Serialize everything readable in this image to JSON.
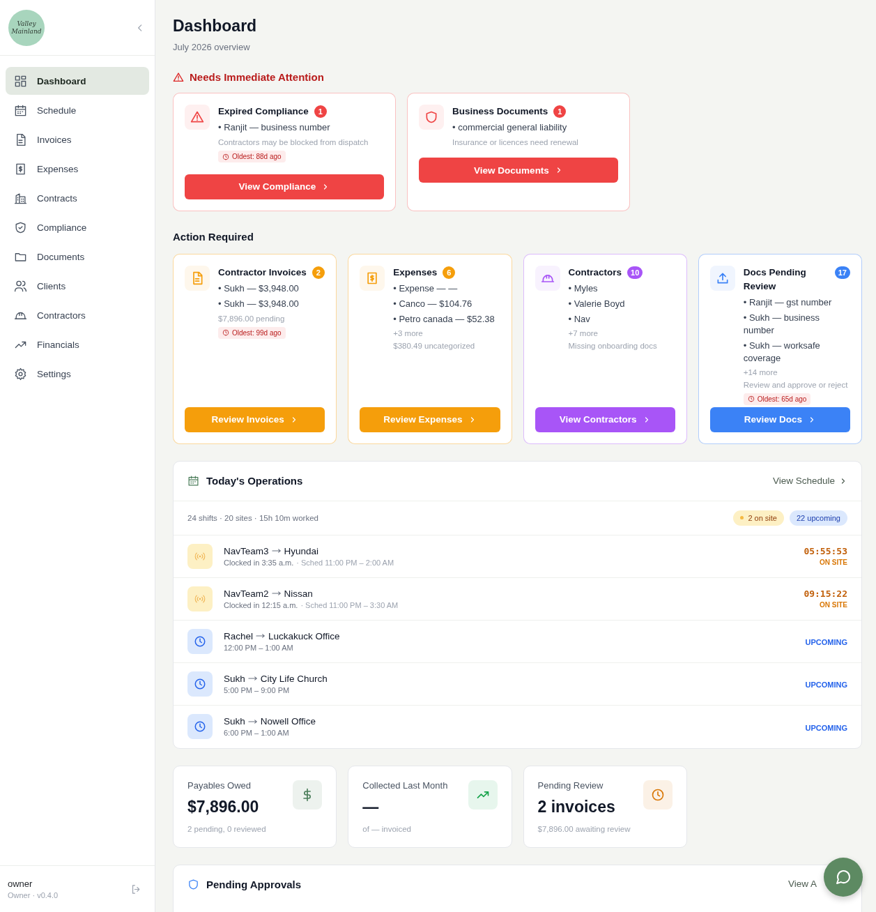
{
  "sidebar": {
    "logo_text": "Valley Mainland",
    "items": [
      {
        "label": "Dashboard",
        "selected": true
      },
      {
        "label": "Schedule",
        "selected": false
      },
      {
        "label": "Invoices",
        "selected": false
      },
      {
        "label": "Expenses",
        "selected": false
      },
      {
        "label": "Contracts",
        "selected": false
      },
      {
        "label": "Compliance",
        "selected": false
      },
      {
        "label": "Documents",
        "selected": false
      },
      {
        "label": "Clients",
        "selected": false
      },
      {
        "label": "Contractors",
        "selected": false
      },
      {
        "label": "Financials",
        "selected": false
      },
      {
        "label": "Settings",
        "selected": false
      }
    ],
    "user": {
      "name": "owner",
      "role": "Owner · v0.4.0"
    }
  },
  "header": {
    "title": "Dashboard",
    "subtitle": "July 2026 overview"
  },
  "attention": {
    "title": "Needs Immediate Attention",
    "cards": [
      {
        "title": "Expired Compliance",
        "count": "1",
        "color": "#ef4444",
        "lines": [
          "• Ranjit — business number"
        ],
        "note": "Contractors may be blocked from dispatch",
        "oldest": "Oldest: 88d ago",
        "button": "View Compliance"
      },
      {
        "title": "Business Documents",
        "count": "1",
        "color": "#ef4444",
        "lines": [
          "• commercial general liability"
        ],
        "note": "Insurance or licences need renewal",
        "button": "View Documents"
      }
    ]
  },
  "action": {
    "title": "Action Required",
    "cards": [
      {
        "title": "Contractor Invoices",
        "count": "2",
        "color": "#f59e0b",
        "lines": [
          "• Sukh — $3,948.00",
          "• Sukh — $3,948.00"
        ],
        "note": "$7,896.00 pending",
        "oldest": "Oldest: 99d ago",
        "button": "Review Invoices"
      },
      {
        "title": "Expenses",
        "count": "6",
        "color": "#f59e0b",
        "lines": [
          "• Expense — —",
          "• Canco — $104.76",
          "• Petro canada — $52.38"
        ],
        "more": "+3 more",
        "note": "$380.49 uncategorized",
        "button": "Review Expenses"
      },
      {
        "title": "Contractors",
        "count": "10",
        "color": "#a855f7",
        "lines": [
          "• Myles",
          "• Valerie Boyd",
          "• Nav"
        ],
        "more": "+7 more",
        "note": "Missing onboarding docs",
        "button": "View Contractors"
      },
      {
        "title": "Docs Pending Review",
        "count": "17",
        "color": "#3b82f6",
        "lines": [
          "• Ranjit — gst number",
          "• Sukh — business number",
          "• Sukh — worksafe coverage"
        ],
        "more": "+14 more",
        "note": "Review and approve or reject",
        "oldest": "Oldest: 65d ago",
        "button": "Review Docs"
      }
    ]
  },
  "operations": {
    "title": "Today's Operations",
    "link": "View Schedule",
    "summary": "24 shifts · 20 sites · 15h 10m worked",
    "chips": [
      {
        "label": "2 on site",
        "kind": "onsite"
      },
      {
        "label": "22 upcoming",
        "kind": "upcoming"
      }
    ],
    "rows": [
      {
        "kind": "onsite",
        "name": "NavTeam3",
        "site": "Hyundai",
        "detail": "Clocked in 3:35 a.m.",
        "sched": "· Sched 11:00 PM – 2:00 AM",
        "timer": "05:55:53",
        "status": "ON SITE"
      },
      {
        "kind": "onsite",
        "name": "NavTeam2",
        "site": "Nissan",
        "detail": "Clocked in 12:15 a.m.",
        "sched": "· Sched 11:00 PM – 3:30 AM",
        "timer": "09:15:22",
        "status": "ON SITE"
      },
      {
        "kind": "upcoming",
        "name": "Rachel",
        "site": "Luckakuck Office",
        "detail": "12:00 PM – 1:00 AM",
        "status": "UPCOMING"
      },
      {
        "kind": "upcoming",
        "name": "Sukh",
        "site": "City Life Church",
        "detail": "5:00 PM – 9:00 PM",
        "status": "UPCOMING"
      },
      {
        "kind": "upcoming",
        "name": "Sukh",
        "site": "Nowell Office",
        "detail": "6:00 PM – 1:00 AM",
        "status": "UPCOMING"
      }
    ]
  },
  "stats": [
    {
      "label": "Payables Owed",
      "value": "$7,896.00",
      "note": "2 pending, 0 reviewed"
    },
    {
      "label": "Collected Last Month",
      "value": "—",
      "note": "of — invoiced"
    },
    {
      "label": "Pending Review",
      "value": "2 invoices",
      "note": "$7,896.00 awaiting review"
    }
  ],
  "approvals": {
    "title": "Pending Approvals",
    "link": "View A"
  }
}
